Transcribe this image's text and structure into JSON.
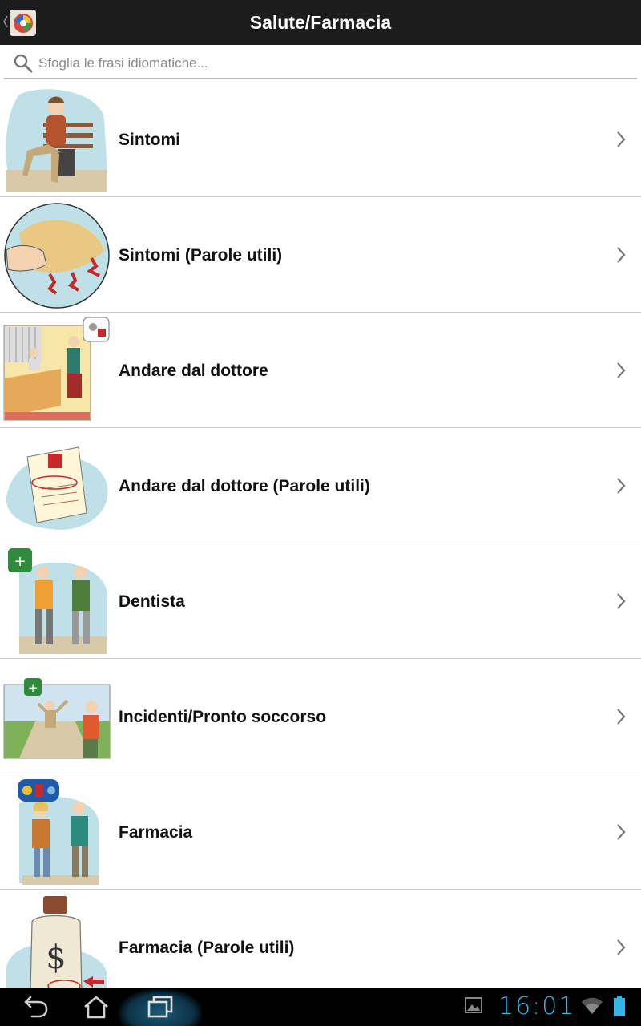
{
  "header": {
    "title": "Salute/Farmacia",
    "back_icon": "chevron-left-icon",
    "app_icon": "globe-flags-icon"
  },
  "search": {
    "placeholder": "Sfoglia le frasi idiomatiche...",
    "value": "",
    "icon": "search-icon"
  },
  "items": [
    {
      "label": "Sintomi",
      "image": "man-on-bench-illustration"
    },
    {
      "label": "Sintomi (Parole utili)",
      "image": "hand-pain-illustration"
    },
    {
      "label": "Andare dal dottore",
      "image": "doctor-office-illustration"
    },
    {
      "label": "Andare dal dottore (Parole utili)",
      "image": "prescription-illustration"
    },
    {
      "label": "Dentista",
      "image": "two-men-dentist-illustration"
    },
    {
      "label": "Incidenti/Pronto soccorso",
      "image": "accident-illustration"
    },
    {
      "label": "Farmacia",
      "image": "pharmacy-couple-illustration"
    },
    {
      "label": "Farmacia (Parole utili)",
      "image": "medicine-bottle-illustration"
    }
  ],
  "status": {
    "time": "16:01",
    "wifi_icon": "wifi-icon",
    "battery_icon": "battery-icon",
    "gallery_icon": "gallery-notification-icon"
  },
  "nav": {
    "back_icon": "back-icon",
    "home_icon": "home-icon",
    "recents_icon": "recent-apps-icon"
  },
  "colors": {
    "action_bar": "#1c1c1c",
    "accent_clock": "#33b5e5",
    "divider": "#cfcfcf"
  }
}
